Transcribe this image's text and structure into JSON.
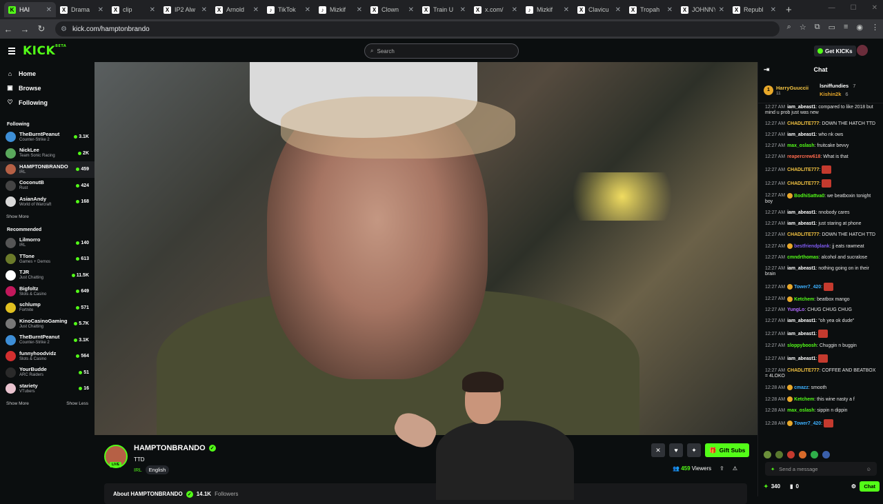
{
  "browser": {
    "tabs": [
      {
        "title": "HAI",
        "icon": "K",
        "color": "#53fc18",
        "active": true
      },
      {
        "title": "Drama",
        "icon": "X",
        "color": "#000000"
      },
      {
        "title": "clip",
        "icon": "X",
        "color": "#000000"
      },
      {
        "title": "IP2 Alw",
        "icon": "X",
        "color": "#000000"
      },
      {
        "title": "Arnold",
        "icon": "X",
        "color": "#000000"
      },
      {
        "title": "TikTok",
        "icon": "♪",
        "color": "#000000"
      },
      {
        "title": "Mizkif",
        "icon": "♪",
        "color": "#000000"
      },
      {
        "title": "Clown",
        "icon": "X",
        "color": "#000000"
      },
      {
        "title": "Train U",
        "icon": "X",
        "color": "#000000"
      },
      {
        "title": "x.com/",
        "icon": "X",
        "color": "#000000"
      },
      {
        "title": "Mizkif",
        "icon": "♪",
        "color": "#000000"
      },
      {
        "title": "Clavicu",
        "icon": "X",
        "color": "#000000"
      },
      {
        "title": "Tropah",
        "icon": "X",
        "color": "#000000"
      },
      {
        "title": "JOHNNY",
        "icon": "X",
        "color": "#000000"
      },
      {
        "title": "Republ",
        "icon": "X",
        "color": "#000000"
      }
    ],
    "url": "kick.com/hamptonbrando"
  },
  "header": {
    "logo": "KICK",
    "logo_badge": "BETA",
    "search_placeholder": "Search",
    "get_kicks": "Get KICKs"
  },
  "sidebar": {
    "nav": [
      {
        "label": "Home",
        "icon": "home-icon",
        "glyph": "⌂"
      },
      {
        "label": "Browse",
        "icon": "browse-icon",
        "glyph": "▣"
      },
      {
        "label": "Following",
        "icon": "heart-icon",
        "glyph": "♡"
      }
    ],
    "following_title": "Following",
    "following": [
      {
        "name": "TheBurntPeanut",
        "category": "Counter-Strike 2",
        "viewers": "3.1K",
        "color": "#3d8ed6"
      },
      {
        "name": "NickLee",
        "category": "Team Sonic Racing",
        "viewers": "2K",
        "color": "#5aa85c"
      },
      {
        "name": "HAMPTONBRANDO",
        "category": "IRL",
        "viewers": "459",
        "color": "#b66045",
        "selected": true
      },
      {
        "name": "CoconutB",
        "category": "Rust",
        "viewers": "424",
        "color": "#444444"
      },
      {
        "name": "AsianAndy",
        "category": "World of Warcraft",
        "viewers": "168",
        "color": "#d9d9d9"
      }
    ],
    "show_more": "Show More",
    "recommended_title": "Recommended",
    "recommended": [
      {
        "name": "Lilmorro",
        "category": "IRL",
        "viewers": "140",
        "color": "#555555"
      },
      {
        "name": "TTone",
        "category": "Games + Demos",
        "viewers": "613",
        "color": "#6b7a2a"
      },
      {
        "name": "TJR",
        "category": "Just Chatting",
        "viewers": "11.5K",
        "color": "#ffffff"
      },
      {
        "name": "Bigfoltz",
        "category": "Slots & Casino",
        "viewers": "649",
        "color": "#c2185b"
      },
      {
        "name": "schlump",
        "category": "Fortnite",
        "viewers": "571",
        "color": "#e0c020"
      },
      {
        "name": "KinoCasinoGaming",
        "category": "Just Chatting",
        "viewers": "5.7K",
        "color": "#777777"
      },
      {
        "name": "TheBurntPeanut",
        "category": "Counter-Strike 2",
        "viewers": "3.1K",
        "color": "#3d8ed6"
      },
      {
        "name": "funnyhoodvidz",
        "category": "Slots & Casino",
        "viewers": "564",
        "color": "#d32f2f"
      },
      {
        "name": "YourBudde",
        "category": "ARC Raiders",
        "viewers": "51",
        "color": "#2a2a2a"
      },
      {
        "name": "stariety",
        "category": "VTubers",
        "viewers": "16",
        "color": "#e9c3cf"
      }
    ],
    "show_more_2": "Show More",
    "show_less": "Show Less"
  },
  "stream": {
    "channel": "HAMPTONBRANDO",
    "title": "TTD",
    "category": "IRL",
    "language": "English",
    "live_label": "LIVE",
    "viewers": "459",
    "viewers_label": "Viewers",
    "gift_subs": "Gift Subs",
    "about_prefix": "About HAMPTONBRANDO",
    "followers": "14.1K",
    "followers_label": "Followers"
  },
  "chat": {
    "title": "Chat",
    "pinned": {
      "rank": "1",
      "top_user": "HarryGuuccii",
      "top_count": "11",
      "users": [
        {
          "name": "lsniffundies",
          "count": "7"
        },
        {
          "name": "Kishin2k",
          "count": "6"
        }
      ]
    },
    "messages": [
      {
        "time": "12:27 AM",
        "user": "iam_abeast1",
        "color": "#ffffff",
        "text": "compared to like 2018 but mind u prob just was new"
      },
      {
        "time": "12:27 AM",
        "user": "CHADLITE777",
        "color": "#f5c542",
        "text": "DOWN THE HATCH TTD"
      },
      {
        "time": "12:27 AM",
        "user": "iam_abeast1",
        "color": "#ffffff",
        "text": "who nk ows"
      },
      {
        "time": "12:27 AM",
        "user": "max_oslash",
        "color": "#53fc18",
        "text": "fruitcake bevvy"
      },
      {
        "time": "12:27 AM",
        "user": "reapercrew618",
        "color": "#ff6a4d",
        "text": "What is that"
      },
      {
        "time": "12:27 AM",
        "user": "CHADLITE777",
        "color": "#f5c542",
        "text": "",
        "emote": true
      },
      {
        "time": "12:27 AM",
        "user": "CHADLITE777",
        "color": "#f5c542",
        "text": "",
        "emote": true
      },
      {
        "time": "12:27 AM",
        "user": "BodhiSattva0",
        "color": "#53fc18",
        "text": "we beatboxin tonight boy",
        "badge": true
      },
      {
        "time": "12:27 AM",
        "user": "iam_abeast1",
        "color": "#ffffff",
        "text": "nnobody cares"
      },
      {
        "time": "12:27 AM",
        "user": "iam_abeast1",
        "color": "#ffffff",
        "text": "just staring at phone"
      },
      {
        "time": "12:27 AM",
        "user": "CHADLITE777",
        "color": "#f5c542",
        "text": "DOWN THE HATCH TTD"
      },
      {
        "time": "12:27 AM",
        "user": "bestfriendplank",
        "color": "#7f5af0",
        "text": "jj eats rawmeat",
        "badge": true
      },
      {
        "time": "12:27 AM",
        "user": "cmndrthomas",
        "color": "#53fc18",
        "text": "alcohol and sucralose"
      },
      {
        "time": "12:27 AM",
        "user": "iam_abeast1",
        "color": "#ffffff",
        "text": "nothing going on in their brain"
      },
      {
        "time": "12:27 AM",
        "user": "Tower7_420",
        "color": "#3db1ff",
        "text": "",
        "badge": true,
        "emote": true
      },
      {
        "time": "12:27 AM",
        "user": "Ketchem",
        "color": "#53fc18",
        "text": "beatbox mango",
        "badge": true
      },
      {
        "time": "12:27 AM",
        "user": "YungLo",
        "color": "#b06bff",
        "text": "CHUG CHUG CHUG"
      },
      {
        "time": "12:27 AM",
        "user": "iam_abeast1",
        "color": "#ffffff",
        "text": "\"oh yea ok dude\""
      },
      {
        "time": "12:27 AM",
        "user": "iam_abeast1",
        "color": "#ffffff",
        "text": "",
        "emote": true
      },
      {
        "time": "12:27 AM",
        "user": "sloppyboosh",
        "color": "#53fc18",
        "text": "Chuggin n buggin"
      },
      {
        "time": "12:27 AM",
        "user": "iam_abeast1",
        "color": "#ffffff",
        "text": "",
        "emote": true
      },
      {
        "time": "12:27 AM",
        "user": "CHADLITE777",
        "color": "#f5c542",
        "text": "COFFEE AND BEATBOX = 4LOKO"
      },
      {
        "time": "12:28 AM",
        "user": "cmazz",
        "color": "#3db1ff",
        "text": "smooth",
        "badge": true
      },
      {
        "time": "12:28 AM",
        "user": "Ketchem",
        "color": "#53fc18",
        "text": "this wine nasty a f",
        "badge": true
      },
      {
        "time": "12:28 AM",
        "user": "max_oslash",
        "color": "#53fc18",
        "text": "sippin n dippin"
      },
      {
        "time": "12:28 AM",
        "user": "Tower7_420",
        "color": "#3db1ff",
        "text": "",
        "badge": true,
        "emote": true
      }
    ],
    "input_placeholder": "Send a message",
    "kicks_count": "340",
    "points": "0",
    "send_label": "Chat"
  }
}
